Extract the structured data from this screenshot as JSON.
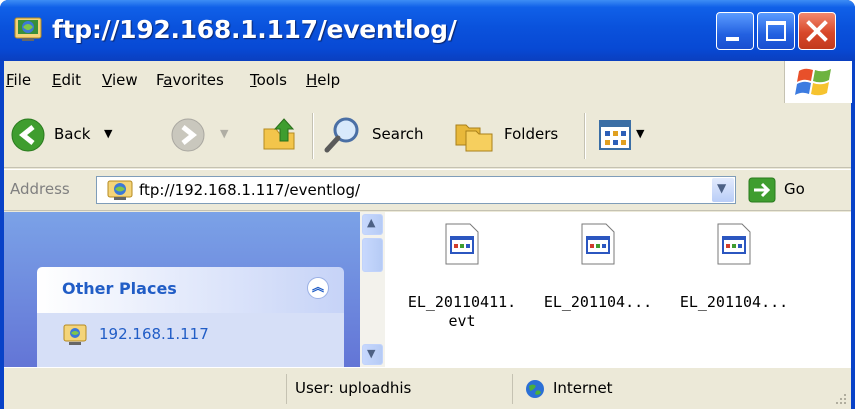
{
  "window": {
    "title": "ftp://192.168.1.117/eventlog/",
    "icon": "ftp-folder-icon"
  },
  "menu": {
    "items": [
      {
        "label": "File",
        "underline": "F"
      },
      {
        "label": "Edit",
        "underline": "E"
      },
      {
        "label": "View",
        "underline": "V"
      },
      {
        "label": "Favorites",
        "underline": "a"
      },
      {
        "label": "Tools",
        "underline": "T"
      },
      {
        "label": "Help",
        "underline": "H"
      }
    ]
  },
  "toolbar": {
    "back_label": "Back",
    "search_label": "Search",
    "folders_label": "Folders"
  },
  "address": {
    "label": "Address",
    "value": "ftp://192.168.1.117/eventlog/",
    "go_label": "Go"
  },
  "sidebar": {
    "section_title": "Other Places",
    "links": [
      "192.168.1.117"
    ]
  },
  "files": [
    {
      "name_line1": "EL_20110411.",
      "name_line2": "evt"
    },
    {
      "name_line1": "EL_201104...",
      "name_line2": ""
    },
    {
      "name_line1": "EL_201104...",
      "name_line2": ""
    }
  ],
  "status": {
    "user": "User: uploadhis",
    "zone": "Internet"
  },
  "colors": {
    "titlebar": "#0a52dc",
    "task_link": "#215dc6",
    "left_pane": "#7ba2e7",
    "chrome": "#ece9d8"
  }
}
